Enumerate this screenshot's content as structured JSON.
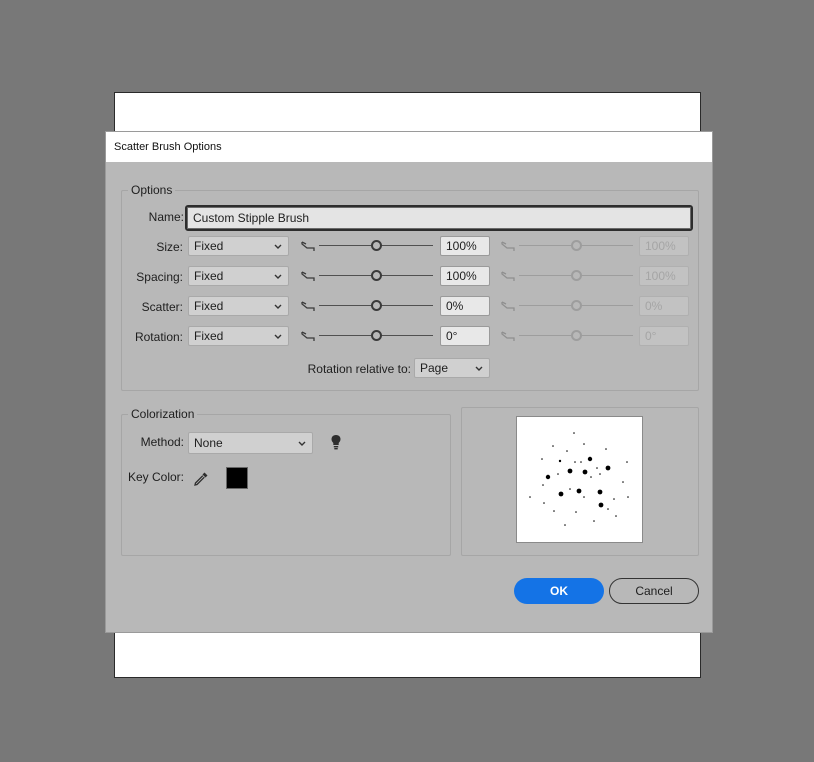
{
  "dialog": {
    "title": "Scatter Brush Options",
    "options_legend": "Options",
    "name_label": "Name:",
    "name_value": "Custom Stipple Brush",
    "rows": [
      {
        "label": "Size:",
        "mode": "Fixed",
        "value": "100%",
        "value2": "100%",
        "slider_pos": 0.5
      },
      {
        "label": "Spacing:",
        "mode": "Fixed",
        "value": "100%",
        "value2": "100%",
        "slider_pos": 0.5
      },
      {
        "label": "Scatter:",
        "mode": "Fixed",
        "value": "0%",
        "value2": "0%",
        "slider_pos": 0.5
      },
      {
        "label": "Rotation:",
        "mode": "Fixed",
        "value": "0°",
        "value2": "0°",
        "slider_pos": 0.5
      }
    ],
    "rotation_relative_label": "Rotation relative to:",
    "rotation_relative_value": "Page",
    "colorization_legend": "Colorization",
    "method_label": "Method:",
    "method_value": "None",
    "key_color_label": "Key Color:",
    "key_color": "#000000",
    "ok_label": "OK",
    "cancel_label": "Cancel"
  },
  "colors": {
    "accent": "#1473e6",
    "dialog_bg": "#b8b8b8",
    "canvas_bg": "#787878"
  },
  "icons": {
    "pressure": "pressure-curve-icon",
    "tips": "lightbulb-icon",
    "eyedropper": "eyedropper-icon",
    "dropdown": "chevron-down-icon"
  }
}
